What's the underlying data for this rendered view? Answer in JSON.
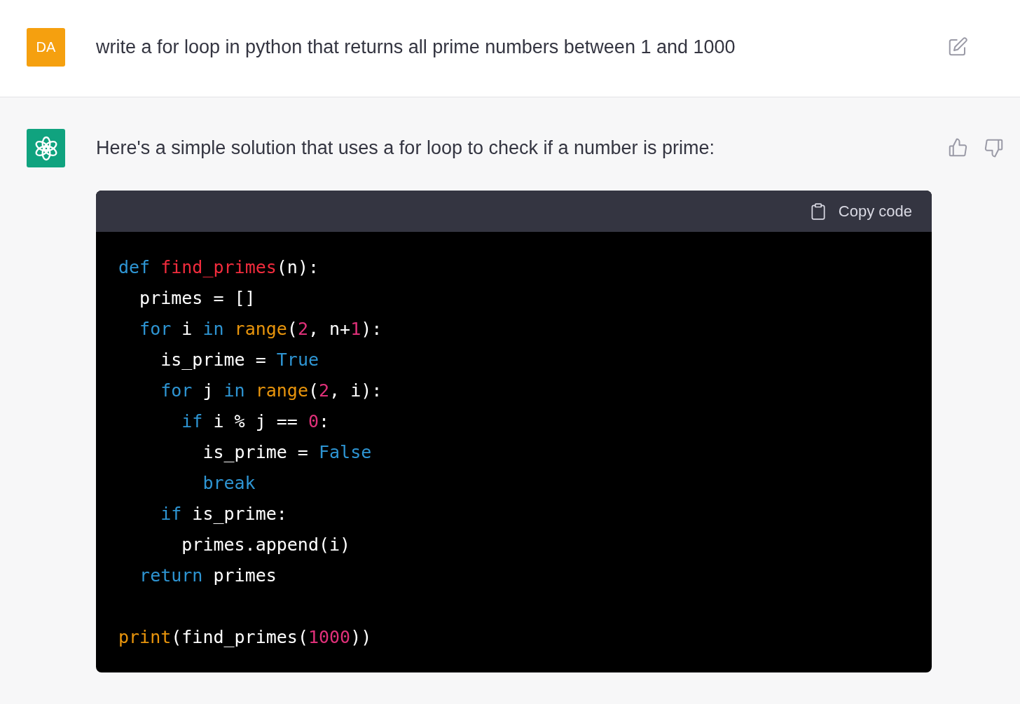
{
  "messages": [
    {
      "kind": "user",
      "avatar": "DA",
      "text": "write a for loop in python that returns all prime numbers between 1 and 1000"
    },
    {
      "kind": "assistant",
      "text": "Here's a simple solution that uses a for loop to check if a number is prime:",
      "code_block": {
        "copy_label": "Copy code",
        "lines": [
          {
            "tokens": [
              {
                "kind": "keyword",
                "text": "def "
              },
              {
                "kind": "function",
                "text": "find_primes"
              },
              {
                "kind": "plain",
                "text": "(n):"
              }
            ]
          },
          {
            "tokens": [
              {
                "kind": "plain",
                "text": "  primes = []"
              }
            ]
          },
          {
            "tokens": [
              {
                "kind": "keyword",
                "text": "  for"
              },
              {
                "kind": "plain",
                "text": " i "
              },
              {
                "kind": "keyword",
                "text": "in "
              },
              {
                "kind": "builtin",
                "text": "range"
              },
              {
                "kind": "plain",
                "text": "("
              },
              {
                "kind": "number",
                "text": "2"
              },
              {
                "kind": "plain",
                "text": ", n+"
              },
              {
                "kind": "number",
                "text": "1"
              },
              {
                "kind": "plain",
                "text": "):"
              }
            ]
          },
          {
            "tokens": [
              {
                "kind": "plain",
                "text": "    is_prime = "
              },
              {
                "kind": "keyword",
                "text": "True"
              }
            ]
          },
          {
            "tokens": [
              {
                "kind": "keyword",
                "text": "    for"
              },
              {
                "kind": "plain",
                "text": " j "
              },
              {
                "kind": "keyword",
                "text": "in "
              },
              {
                "kind": "builtin",
                "text": "range"
              },
              {
                "kind": "plain",
                "text": "("
              },
              {
                "kind": "number",
                "text": "2"
              },
              {
                "kind": "plain",
                "text": ", i):"
              }
            ]
          },
          {
            "tokens": [
              {
                "kind": "keyword",
                "text": "      if"
              },
              {
                "kind": "plain",
                "text": " i % j == "
              },
              {
                "kind": "number",
                "text": "0"
              },
              {
                "kind": "plain",
                "text": ":"
              }
            ]
          },
          {
            "tokens": [
              {
                "kind": "plain",
                "text": "        is_prime = "
              },
              {
                "kind": "keyword",
                "text": "False"
              }
            ]
          },
          {
            "tokens": [
              {
                "kind": "keyword",
                "text": "        break"
              }
            ]
          },
          {
            "tokens": [
              {
                "kind": "keyword",
                "text": "    if"
              },
              {
                "kind": "plain",
                "text": " is_prime:"
              }
            ]
          },
          {
            "tokens": [
              {
                "kind": "plain",
                "text": "      primes.append(i)"
              }
            ]
          },
          {
            "tokens": [
              {
                "kind": "keyword",
                "text": "  return"
              },
              {
                "kind": "plain",
                "text": " primes"
              }
            ]
          },
          {
            "blank_before": true,
            "tokens": [
              {
                "kind": "builtin",
                "text": "print"
              },
              {
                "kind": "plain",
                "text": "(find_primes("
              },
              {
                "kind": "number",
                "text": "1000"
              },
              {
                "kind": "plain",
                "text": "))"
              }
            ]
          }
        ]
      }
    }
  ]
}
